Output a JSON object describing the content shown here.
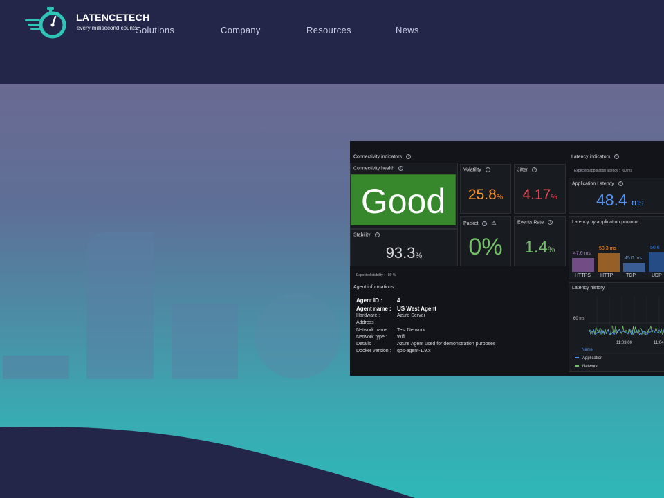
{
  "brand": {
    "name": "LATENCETECH",
    "tagline": "every millisecond counts"
  },
  "nav": {
    "items": [
      {
        "label": "Solutions"
      },
      {
        "label": "Company"
      },
      {
        "label": "Resources"
      },
      {
        "label": "News"
      }
    ]
  },
  "colors": {
    "header_bg": "#232648",
    "accent": "#2ec4b6",
    "good": "#37872d",
    "orange": "#ff9830",
    "red": "#f2495c",
    "green": "#73bf69",
    "blue": "#5794f2",
    "purple": "#b877d9"
  },
  "dashboard": {
    "connectivity": {
      "title": "Connectivity indicators",
      "health_title": "Connectivity health",
      "health_value": "Good",
      "volatility_title": "Volatility",
      "volatility_value": "25.8",
      "volatility_unit": "%",
      "jitter_title": "Jitter",
      "jitter_value": "4.17",
      "jitter_unit": "%",
      "stability_title": "Stability",
      "stability_value": "93.3",
      "stability_unit": "%",
      "packet_title": "Packet",
      "packet_value": "0%",
      "events_title": "Events Rate",
      "events_value": "1.4",
      "events_unit": "%",
      "expected_stability_label": "Expected stability :",
      "expected_stability_value": "80 %"
    },
    "agent": {
      "title": "Agent informations",
      "rows": [
        {
          "key": "Agent ID :",
          "value": "4"
        },
        {
          "key": "Agent name :",
          "value": "US West Agent"
        },
        {
          "key": "Hardware :",
          "value": "Azure Server"
        },
        {
          "key": "Address :",
          "value": ""
        },
        {
          "key": "Network name :",
          "value": "Test Network"
        },
        {
          "key": "Network type :",
          "value": "Wifi"
        },
        {
          "key": "Details :",
          "value": "Azure Agent used for demonstration purposes"
        },
        {
          "key": "Docker version :",
          "value": "qos-agent-1.9.x"
        }
      ]
    },
    "latency": {
      "title": "Latency indicators",
      "expected_label": "Expected application latency :",
      "expected_value": "60 ms",
      "app_latency_title": "Application Latency",
      "app_latency_value": "48.4",
      "app_latency_unit": "ms",
      "protocol_title": "Latency by application protocol",
      "history_title": "Latency history"
    }
  },
  "chart_data": [
    {
      "type": "bar",
      "title": "Latency by application protocol",
      "categories": [
        "HTTPS",
        "HTTP",
        "TCP",
        "UDP"
      ],
      "values": [
        47.6,
        50.3,
        45.0,
        50.6
      ],
      "value_labels": [
        "47.6 ms",
        "50.3 ms",
        "45.0 ms",
        "50.6"
      ],
      "bar_colors": [
        "#b877d9",
        "#ff9830",
        "#5794f2",
        "#3274d9"
      ],
      "ylim": [
        40,
        52
      ]
    },
    {
      "type": "line",
      "title": "Latency history",
      "y_tick": "60 ms",
      "x_ticks": [
        "11:03:00",
        "11:04"
      ],
      "legend_header": "Name",
      "series": [
        {
          "name": "Application",
          "color": "#5794f2"
        },
        {
          "name": "Network",
          "color": "#73bf69"
        }
      ]
    }
  ]
}
